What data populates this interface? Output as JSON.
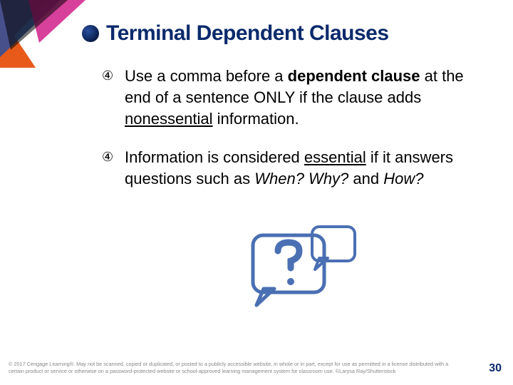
{
  "title": "Terminal Dependent Clauses",
  "bullets": {
    "b1": {
      "marker": "④",
      "t1": "Use a comma before a ",
      "t2": "dependent clause",
      "t3": " at the end of a sentence ONLY if the clause adds ",
      "t4": "nonessential",
      "t5": " information."
    },
    "b2": {
      "marker": "④",
      "t1": "Information is considered ",
      "t2": "essential",
      "t3": " if it answers questions such as ",
      "t4": "When? Why?",
      "t5": " and ",
      "t6": "How?"
    }
  },
  "copyright": "© 2017 Cengage Learning®. May not be scanned, copied or duplicated, or posted to a publicly accessible website, in whole or in part, except for use as permitted in a license distributed with a certain product or service or otherwise on a password-protected website or school-approved learning management system for classroom use. ©Larysa Ray/Shutterstock",
  "page_number": "30"
}
